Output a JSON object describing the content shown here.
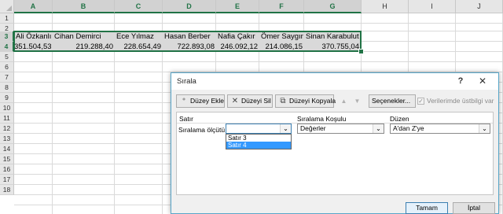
{
  "spreadsheet": {
    "columns": [
      "A",
      "B",
      "C",
      "D",
      "E",
      "F",
      "G",
      "H",
      "I",
      "J"
    ],
    "rows": [
      "1",
      "2",
      "3",
      "4",
      "5",
      "6",
      "7",
      "8",
      "9",
      "10",
      "11",
      "12",
      "13",
      "14",
      "15",
      "16",
      "17",
      "18"
    ],
    "row3": [
      "Ali Özkanlı",
      "Cihan Demirci",
      "Ece Yılmaz",
      "Hasan Berber",
      "Nafia Çakır",
      "Ömer Saygın",
      "Sinan Karabulut"
    ],
    "row4": [
      "351.504,53",
      "219.288,40",
      "228.654,49",
      "722.893,08",
      "246.092,12",
      "214.086,15",
      "370.755,04"
    ]
  },
  "dialog": {
    "title": "Sırala",
    "help": "?",
    "close": "✕",
    "toolbar": {
      "add_level": "Düzey Ekle",
      "delete_level": "Düzeyi Sil",
      "copy_level": "Düzeyi Kopyala",
      "move_up": "▲",
      "move_down": "▼",
      "options": "Seçenekler...",
      "header_checkbox": "Verilerimde üstbilgi var"
    },
    "headers": {
      "row": "Satır",
      "sort_on": "Sıralama Koşulu",
      "order": "Düzen"
    },
    "level1": {
      "label": "Sıralama ölçütü",
      "row_value": "",
      "sort_on_value": "Değerler",
      "order_value": "A'dan Z'ye"
    },
    "dropdown_options": [
      "Satır 3",
      "Satır 4"
    ],
    "dropdown_selected": "Satır 4",
    "ok": "Tamam",
    "cancel": "İptal"
  }
}
